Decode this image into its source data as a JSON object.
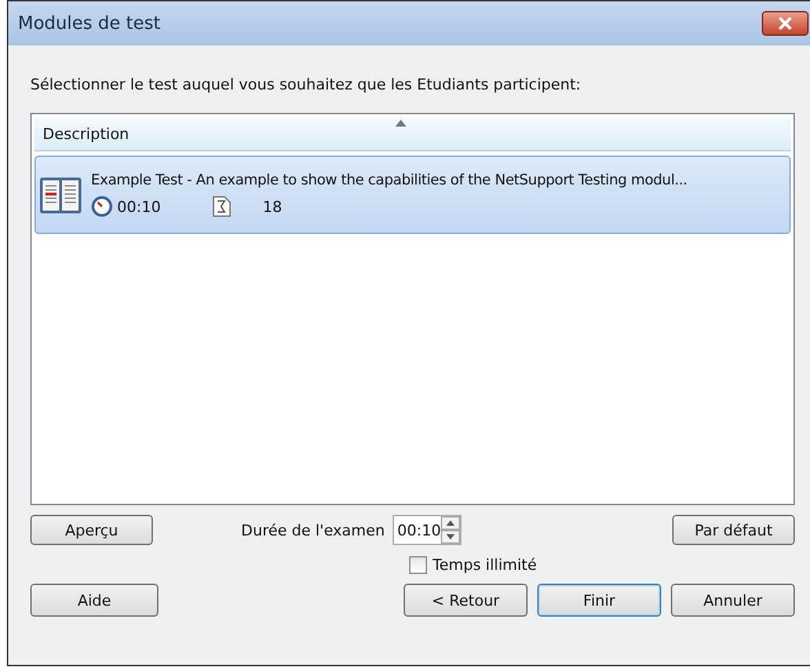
{
  "window": {
    "title": "Modules de test"
  },
  "instruction": "Sélectionner le test auquel vous souhaitez que les Etudiants participent:",
  "list": {
    "columns": [
      "Description"
    ],
    "rows": [
      {
        "title": "Example Test - An example to show the capabilities of the NetSupport Testing modul...",
        "duration": "00:10",
        "questions": "18",
        "selected": true
      }
    ]
  },
  "preview_button": "Aperçu",
  "duration": {
    "label": "Durée de l'examen",
    "value": "00:10"
  },
  "default_button": "Par défaut",
  "unlimited": {
    "label": "Temps illimité",
    "checked": false
  },
  "buttons": [
    {
      "label": "Aide",
      "kind": "left",
      "selected": false
    },
    {
      "label": "< Retour",
      "kind": "right",
      "selected": false
    },
    {
      "label": "Finir",
      "kind": "right",
      "selected": true
    },
    {
      "label": "Annuler",
      "kind": "right",
      "selected": false
    }
  ]
}
